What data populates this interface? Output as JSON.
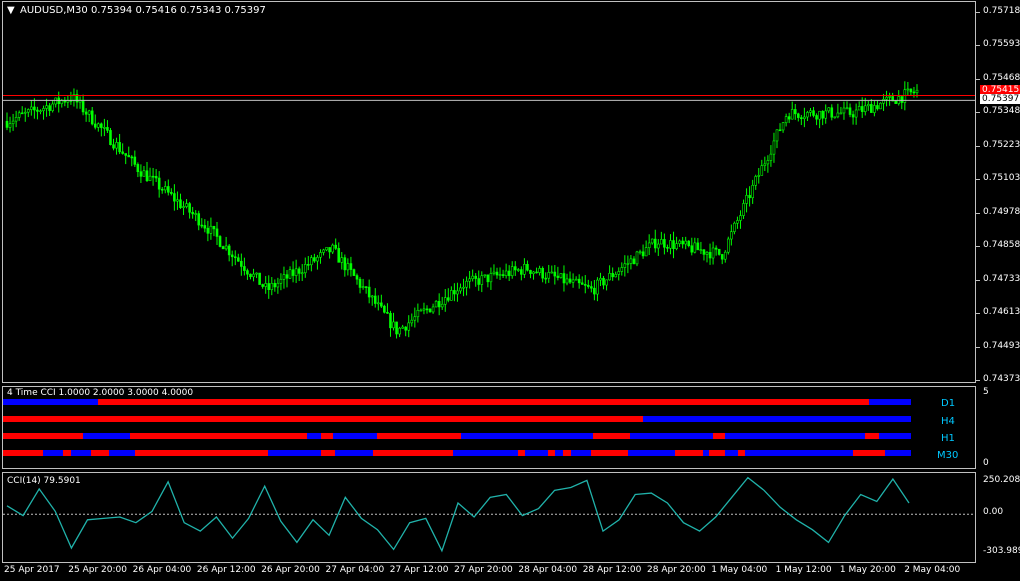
{
  "main": {
    "header": "AUDUSD,M30  0.75394 0.75416 0.75343 0.75397",
    "y_labels": [
      "0.75718",
      "0.75593",
      "0.75468",
      "0.75348",
      "0.75223",
      "0.75103",
      "0.74978",
      "0.74858",
      "0.74733",
      "0.74613",
      "0.74493",
      "0.74373"
    ],
    "bid_label": "0.75397",
    "ask_label": "0.75415",
    "colors": {
      "candle": "#00ff00",
      "ask_line": "#ff0000",
      "bid_line": "#c0c0c0",
      "bg": "#000000"
    }
  },
  "tcci": {
    "header": "4 Time CCI 1.0000 2.0000 3.0000 4.0000",
    "y_labels": [
      "5",
      "0"
    ],
    "timeframes": [
      "D1",
      "H4",
      "H1",
      "M30"
    ],
    "colors": {
      "up": "#ff0000",
      "down": "#0000ff",
      "label": "#00c8ff"
    }
  },
  "cci": {
    "header": "CCI(14) 79.5901",
    "y_labels": [
      "250.2083",
      "0.00",
      "-303.9891"
    ],
    "colors": {
      "line": "#20b2aa",
      "zero": "#c0c0c0"
    }
  },
  "x_labels": [
    "25 Apr 2017",
    "25 Apr 20:00",
    "26 Apr 04:00",
    "26 Apr 12:00",
    "26 Apr 20:00",
    "27 Apr 04:00",
    "27 Apr 12:00",
    "27 Apr 20:00",
    "28 Apr 04:00",
    "28 Apr 12:00",
    "28 Apr 20:00",
    "1 May 04:00",
    "1 May 12:00",
    "1 May 20:00",
    "2 May 04:00"
  ],
  "chart_data": [
    {
      "type": "line",
      "symbol": "AUDUSD",
      "timeframe": "M30",
      "x": [
        "25 Apr 2017",
        "25 Apr 20:00",
        "26 Apr 04:00",
        "26 Apr 12:00",
        "26 Apr 20:00",
        "27 Apr 04:00",
        "27 Apr 12:00",
        "27 Apr 20:00",
        "28 Apr 04:00",
        "28 Apr 12:00",
        "28 Apr 20:00",
        "1 May 04:00",
        "1 May 12:00",
        "1 May 20:00",
        "2 May 04:00"
      ],
      "series": [
        {
          "values": [
            0.7532,
            0.7541,
            0.7515,
            0.7495,
            0.747,
            0.7485,
            0.7455,
            0.7472,
            0.7478,
            0.747,
            0.7488,
            0.7483,
            0.7535,
            0.7535,
            0.7543
          ]
        }
      ],
      "ylim": [
        0.74373,
        0.75718
      ],
      "current": {
        "open": 0.75394,
        "high": 0.75416,
        "low": 0.75343,
        "close": 0.75397,
        "bid": 0.75397,
        "ask": 0.75415
      }
    },
    {
      "type": "line",
      "name": "CCI(14)",
      "last_value": 79.5901,
      "ylim": [
        -303.9891,
        250.2083
      ],
      "values": [
        60,
        -10,
        180,
        20,
        -240,
        -40,
        -30,
        -20,
        -60,
        20,
        230,
        -60,
        -120,
        -20,
        -170,
        -30,
        200,
        -50,
        -200,
        -40,
        -150,
        120,
        -30,
        -110,
        -250,
        -60,
        -30,
        -260,
        80,
        -20,
        120,
        140,
        -10,
        40,
        170,
        190,
        240,
        -120,
        -40,
        140,
        150,
        80,
        -60,
        -120,
        -20,
        120,
        260,
        170,
        50,
        -40,
        -110,
        -200,
        -10,
        140,
        90,
        250,
        79.59
      ]
    }
  ]
}
